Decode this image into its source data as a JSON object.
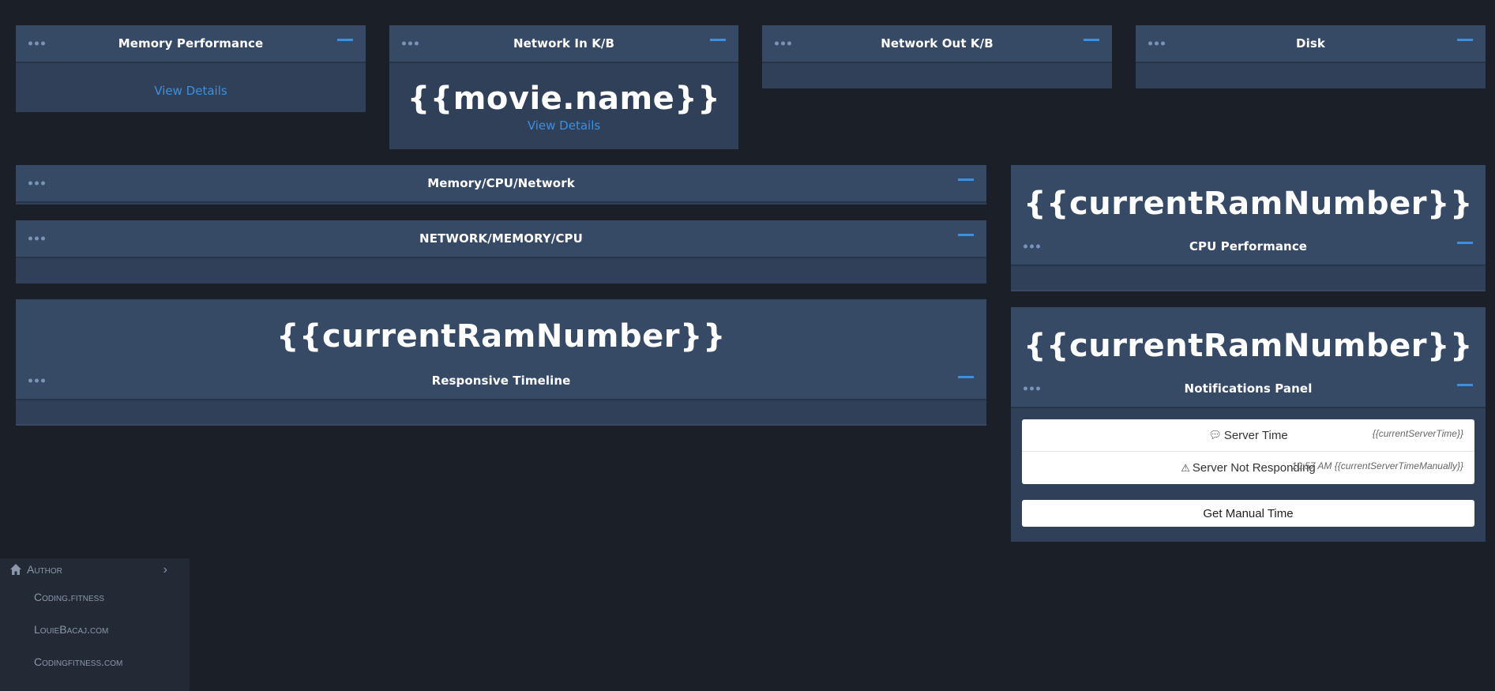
{
  "panels": {
    "memory_performance": {
      "title": "Memory Performance",
      "link": "View Details"
    },
    "network_in": {
      "title": "Network In K/B",
      "value": "{{movie.name}}",
      "link": "View Details"
    },
    "network_out": {
      "title": "Network Out K/B"
    },
    "disk": {
      "title": "Disk"
    },
    "memory_cpu_network": {
      "title": "Memory/CPU/Network"
    },
    "network_memory_cpu": {
      "title": "NETWORK/MEMORY/CPU"
    },
    "responsive_timeline": {
      "title": "Responsive Timeline",
      "value": "{{currentRamNumber}}"
    },
    "cpu_performance": {
      "title": "CPU Performance",
      "value": "{{currentRamNumber}}"
    },
    "notifications": {
      "title": "Notifications Panel",
      "value": "{{currentRamNumber}}",
      "items": [
        {
          "icon": "comment-icon",
          "label": "Server Time",
          "time": "{{currentServerTime}}"
        },
        {
          "icon": "warning-icon",
          "label": "Server Not Responding",
          "time": "10:57 AM {{currentServerTimeManually}}"
        }
      ],
      "button": "Get Manual Time"
    }
  },
  "sidebar": {
    "parent": "Author",
    "items": [
      "Coding.fitness",
      "LouieBacaj.com",
      "Codingfitness.com"
    ]
  },
  "colors": {
    "background": "#1b1f27",
    "panel": "#2f4058",
    "panel_header": "#364a66",
    "accent": "#3d8fe0"
  }
}
